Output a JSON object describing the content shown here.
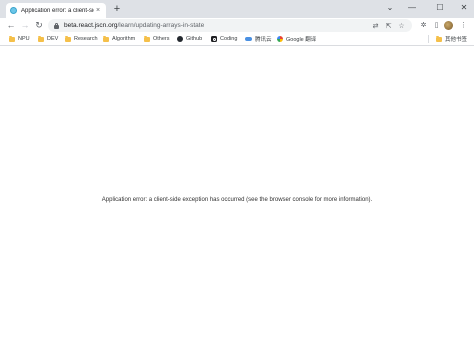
{
  "tab": {
    "title": "Application error: a client-side",
    "close": "×"
  },
  "tabstrip": {
    "new_tab": "+",
    "chevron": "⌄"
  },
  "window": {
    "minimize": "—",
    "maximize": "☐",
    "close": "✕"
  },
  "toolbar": {
    "back": "←",
    "forward": "→",
    "reload": "↻",
    "url_host": "beta.react.jscn.org",
    "url_path": "/learn/updating-arrays-in-state",
    "translate": "⇄",
    "share": "⇱",
    "bookmark_star": "☆",
    "extensions": "✲",
    "downloads": "⬇",
    "side_panel": "▯",
    "menu": "⋮"
  },
  "bookmarks": {
    "items": [
      {
        "label": "NPU",
        "icon": "folder-icon"
      },
      {
        "label": "DEV",
        "icon": "folder-icon"
      },
      {
        "label": "Research",
        "icon": "folder-icon"
      },
      {
        "label": "Algorithm",
        "icon": "folder-icon"
      },
      {
        "label": "Others",
        "icon": "folder-icon"
      },
      {
        "label": "Github",
        "icon": "github-icon"
      },
      {
        "label": "Coding",
        "icon": "coding-icon"
      },
      {
        "label": "腾讯云",
        "icon": "cloud-icon"
      },
      {
        "label": "Google 翻译",
        "icon": "google-icon"
      }
    ],
    "other_bookmarks": "其他书签"
  },
  "content": {
    "error_message": "Application error: a client-side exception has occurred (see the browser console for more information)."
  },
  "colors": {
    "tabstrip_bg": "#dee1e6",
    "omnibox_bg": "#f1f3f4",
    "folder": "#f5c04a",
    "text": "#202124",
    "muted": "#5f6368"
  }
}
